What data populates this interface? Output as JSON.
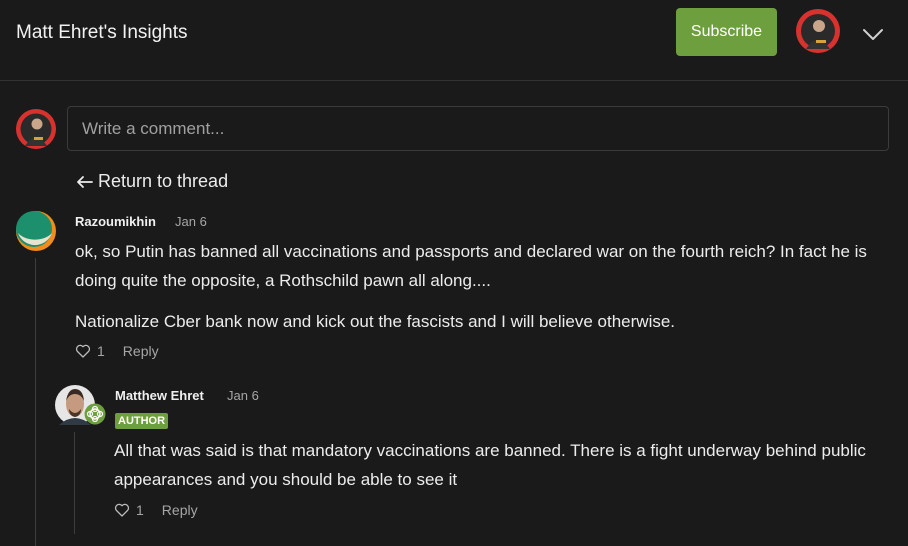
{
  "header": {
    "title": "Matt Ehret's Insights",
    "subscribe_label": "Subscribe"
  },
  "composer": {
    "placeholder": "Write a comment..."
  },
  "nav": {
    "return_label": "Return to thread"
  },
  "comments": [
    {
      "author": "Razoumikhin",
      "date": "Jan 6",
      "paragraphs": [
        "ok, so Putin has banned all vaccinations and passports and declared war on the fourth reich? In fact he is doing quite the opposite, a Rothschild pawn all along....",
        "Nationalize Cber bank now and kick out the fascists and I will believe otherwise."
      ],
      "likes": "1",
      "reply_label": "Reply"
    },
    {
      "author": "Matthew Ehret",
      "date": "Jan 6",
      "badge": "AUTHOR",
      "paragraphs": [
        "All that was said is that mandatory vaccinations are banned. There is a fight underway behind public appearances and you should be able to see it"
      ],
      "likes": "1",
      "reply_label": "Reply"
    }
  ],
  "colors": {
    "background": "#1a1a1a",
    "accent": "#6e9f3e",
    "muted_text": "#a6a6a6"
  },
  "icons": [
    "chevron-down-icon",
    "arrow-left-icon",
    "heart-icon",
    "author-icon",
    "avatar"
  ]
}
